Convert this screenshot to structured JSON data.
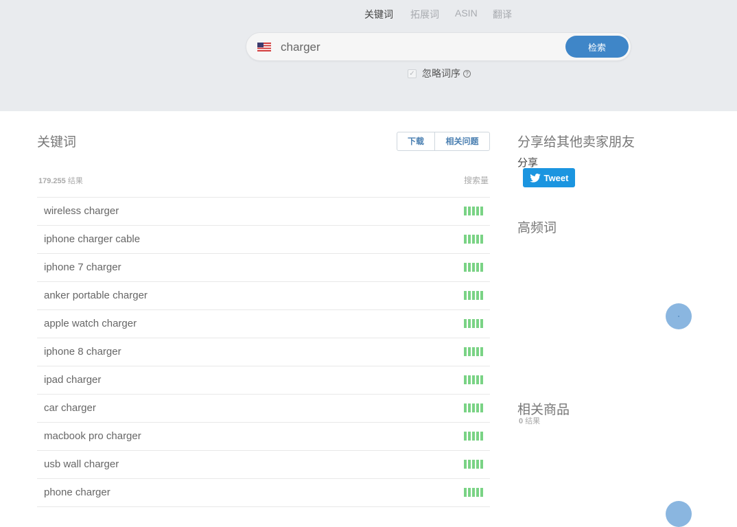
{
  "tabs": [
    {
      "label": "关键词",
      "active": true
    },
    {
      "label": "拓展词",
      "active": false
    },
    {
      "label": "ASIN",
      "active": false
    },
    {
      "label": "翻译",
      "active": false
    }
  ],
  "search": {
    "value": "charger",
    "button_label": "检索",
    "region_icon": "us-flag-icon"
  },
  "ignore_order": {
    "label": "忽略词序",
    "checked": true
  },
  "keywords_section": {
    "title": "关键词",
    "download_label": "下载",
    "related_questions_label": "相关问题",
    "result_count": "179.255",
    "result_suffix": "结果",
    "volume_label": "搜索量",
    "items": [
      {
        "text": "wireless charger",
        "volume_bars": 5
      },
      {
        "text": "iphone charger cable",
        "volume_bars": 5
      },
      {
        "text": "iphone 7 charger",
        "volume_bars": 5
      },
      {
        "text": "anker portable charger",
        "volume_bars": 5
      },
      {
        "text": "apple watch charger",
        "volume_bars": 5
      },
      {
        "text": "iphone 8 charger",
        "volume_bars": 5
      },
      {
        "text": "ipad charger",
        "volume_bars": 5
      },
      {
        "text": "car charger",
        "volume_bars": 5
      },
      {
        "text": "macbook pro charger",
        "volume_bars": 5
      },
      {
        "text": "usb wall charger",
        "volume_bars": 5
      },
      {
        "text": "phone charger",
        "volume_bars": 5
      }
    ]
  },
  "share_section": {
    "title": "分享给其他卖家朋友",
    "share_label": "分享",
    "tweet_label": "Tweet"
  },
  "frequent_section": {
    "title": "高频词"
  },
  "products_section": {
    "title": "相关商品",
    "count": "0",
    "count_suffix": "结果"
  },
  "colors": {
    "accent": "#3f86c8",
    "volume_bar": "#7ad385",
    "twitter": "#1b95e0"
  }
}
